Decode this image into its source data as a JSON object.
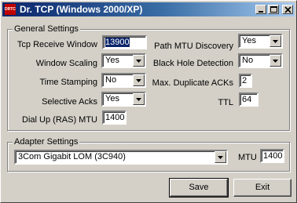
{
  "window": {
    "icon_text": "DRTCP",
    "title": "Dr. TCP (Windows 2000/XP)",
    "title_gradient": [
      "#0a246a",
      "#a6caf0"
    ]
  },
  "general": {
    "legend": "General Settings",
    "tcp_receive_window": {
      "label": "Tcp Receive Window",
      "value": "13900"
    },
    "window_scaling": {
      "label": "Window Scaling",
      "value": "Yes"
    },
    "time_stamping": {
      "label": "Time Stamping",
      "value": "No"
    },
    "selective_acks": {
      "label": "Selective Acks",
      "value": "Yes"
    },
    "dialup_mtu": {
      "label": "Dial Up (RAS) MTU",
      "value": "1400"
    },
    "path_mtu_discovery": {
      "label": "Path MTU Discovery",
      "value": "Yes"
    },
    "black_hole_detection": {
      "label": "Black Hole Detection",
      "value": "No"
    },
    "max_duplicate_acks": {
      "label": "Max. Duplicate ACKs",
      "value": "2"
    },
    "ttl": {
      "label": "TTL",
      "value": "64"
    }
  },
  "adapter": {
    "legend": "Adapter Settings",
    "selected_adapter": "3Com Gigabit LOM (3C940)",
    "mtu_label": "MTU",
    "mtu_value": "1400"
  },
  "buttons": {
    "save": "Save",
    "exit": "Exit"
  },
  "icons": [
    "minimize-icon",
    "maximize-icon",
    "close-icon",
    "chevron-down-icon"
  ]
}
